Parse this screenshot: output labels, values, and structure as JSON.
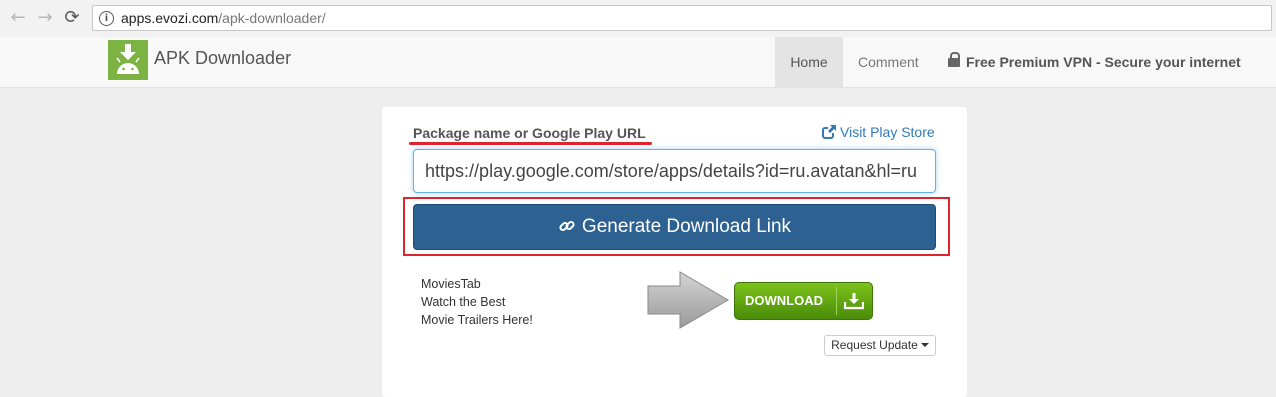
{
  "browser": {
    "back_icon": "←",
    "forward_icon": "→",
    "reload_icon": "⟳",
    "info_icon": "i",
    "url_host": "apps.evozi.com",
    "url_path": "/apk-downloader/"
  },
  "header": {
    "brand": "APK Downloader",
    "nav": {
      "home": "Home",
      "comment": "Comment",
      "vpn": "Free Premium VPN - Secure your internet"
    }
  },
  "form": {
    "label": "Package name or Google Play URL",
    "visit_link": "Visit Play Store",
    "url_value": "https://play.google.com/store/apps/details?id=ru.avatan&hl=ru",
    "generate_button": "Generate Download Link"
  },
  "ad": {
    "line1": "MoviesTab",
    "line2": "Watch the Best",
    "line3": "Movie Trailers Here!",
    "download_button": "DOWNLOAD"
  },
  "request_update": "Request Update",
  "colors": {
    "accent_blue": "#2d6192",
    "link_blue": "#337ab7",
    "highlight_red": "#e0242c",
    "download_green": "#5ea512",
    "android_green": "#7cb342"
  }
}
